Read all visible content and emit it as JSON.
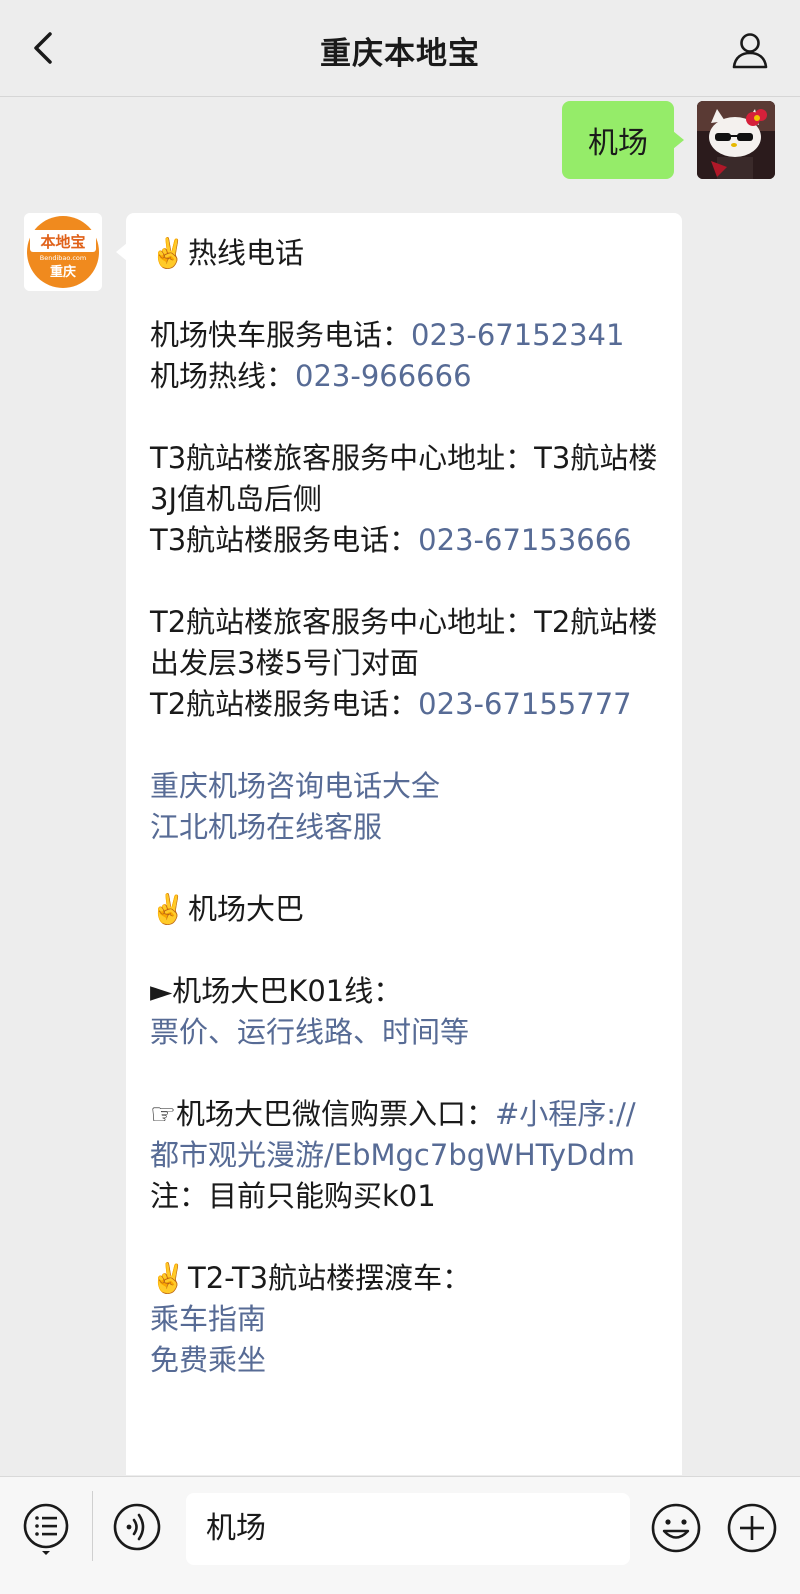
{
  "header": {
    "title": "重庆本地宝"
  },
  "user_message": {
    "text": "机场"
  },
  "bot_avatar": {
    "brand": "本地宝",
    "domain": "Bendibao.com",
    "city": "重庆"
  },
  "reply": {
    "hotline_heading": "热线电话",
    "express_label": "机场快车服务电话：",
    "express_phone": "023-67152341",
    "airport_hotline_label": "机场热线：",
    "airport_hotline_phone": "023-966666",
    "t3_center_addr": "T3航站楼旅客服务中心地址：T3航站楼3J值机岛后侧",
    "t3_phone_label": "T3航站楼服务电话：",
    "t3_phone": "023-67153666",
    "t2_center_addr": "T2航站楼旅客服务中心地址：T2航站楼出发层3楼5号门对面",
    "t2_phone_label": "T2航站楼服务电话：",
    "t2_phone": "023-67155777",
    "link_phone_list": "重庆机场咨询电话大全",
    "link_online_service": "江北机场在线客服",
    "bus_heading": "机场大巴",
    "k01_label": "►机场大巴K01线：",
    "k01_link": "票价、运行线路、时间等",
    "wechat_ticket_label": "☞机场大巴微信购票入口：",
    "wechat_ticket_link": "#小程序://都市观光漫游/EbMgc7bgWHTyDdm",
    "note": "注：目前只能购买k01",
    "shuttle_heading": "T2-T3航站楼摆渡车：",
    "shuttle_guide_link": "乘车指南",
    "shuttle_free_link": "免费乘坐",
    "emoji": "✌️"
  },
  "input": {
    "value": "机场"
  },
  "icons": {
    "back": "chevron-left-icon",
    "profile": "person-icon",
    "menu": "menu-list-icon",
    "voice": "voice-icon",
    "emoji": "smiley-icon",
    "add": "plus-icon"
  },
  "colors": {
    "link": "#576b95",
    "my_bubble": "#95ec69",
    "avatar_orange": "#f08a1e"
  }
}
